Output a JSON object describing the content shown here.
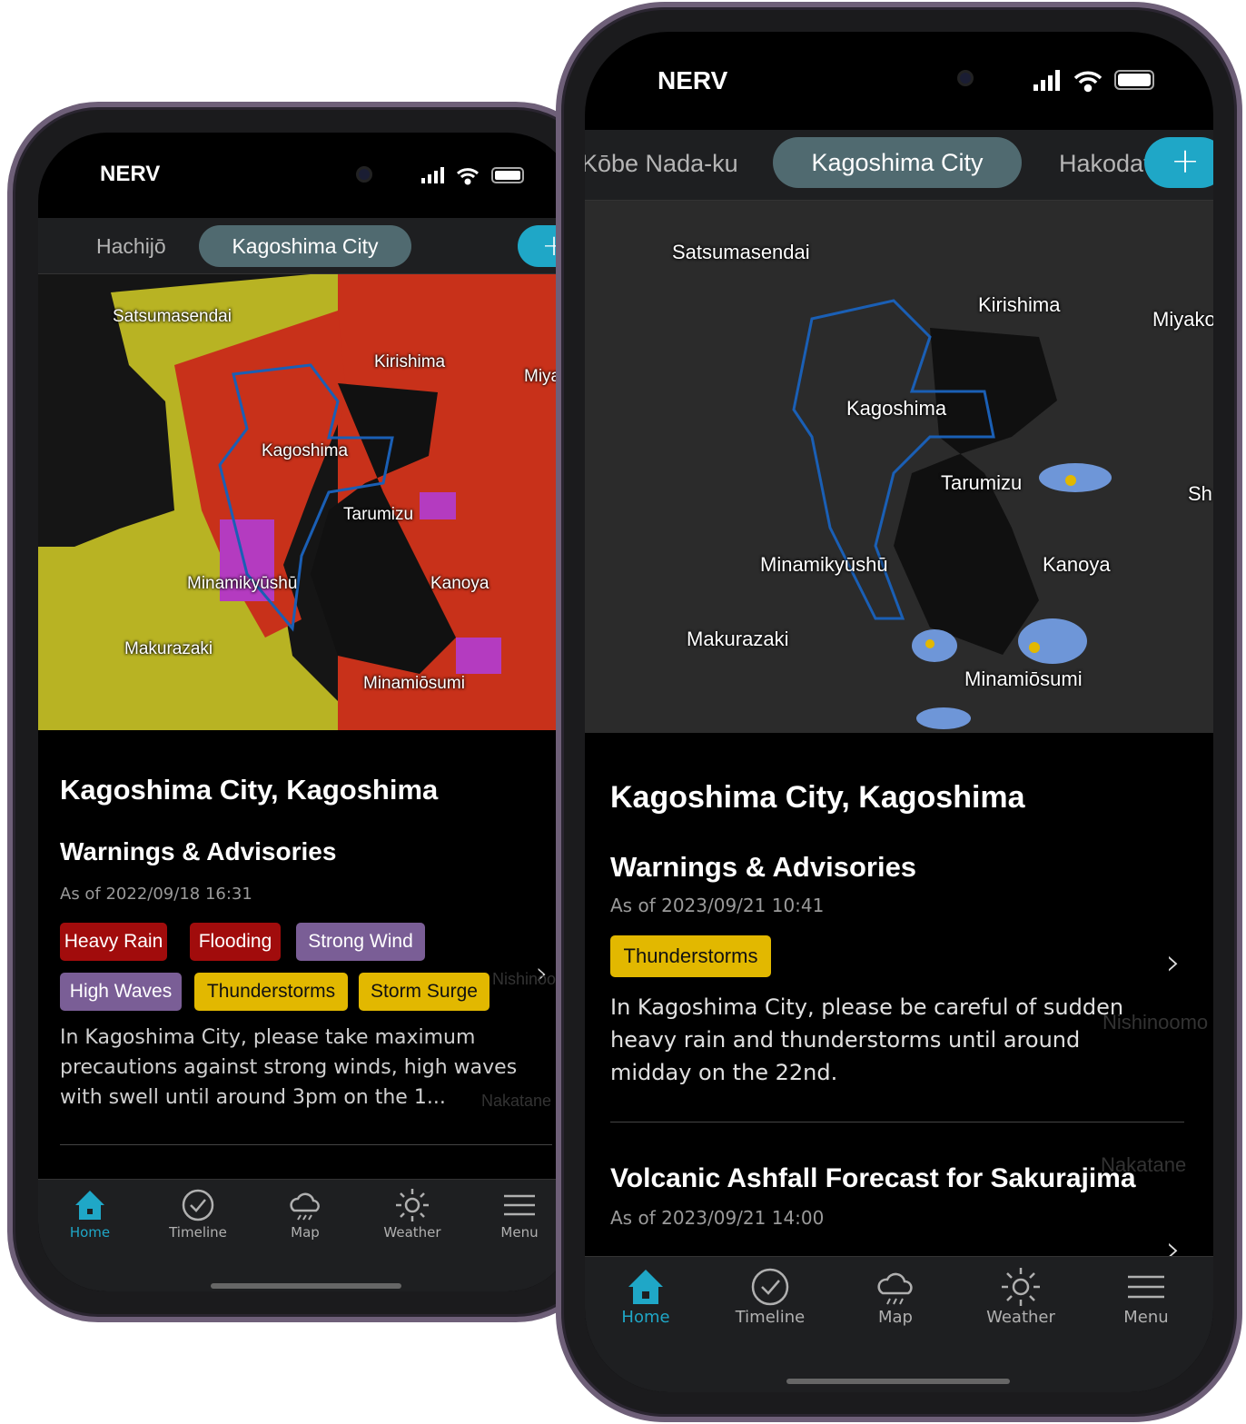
{
  "accent_color": "#1fa7c7",
  "badge_colors": {
    "red": "#a10c0c",
    "purple": "#7a5e96",
    "yellow": "#e2b800"
  },
  "left_phone": {
    "status": {
      "carrier": "NERV",
      "icons": [
        "signal-icon",
        "wifi-icon",
        "battery-icon"
      ]
    },
    "tabs": [
      {
        "label": "Hachijō"
      },
      {
        "label": "Kagoshima City",
        "active": true
      }
    ],
    "add_button": "+",
    "map_labels": [
      "Satsumasendai",
      "Kirishima",
      "Miya",
      "Kagoshima",
      "Tarumizu",
      "Minamikyūshū",
      "Kanoya",
      "Makurazaki",
      "Minamiōsumi"
    ],
    "location_title": "Kagoshima City, Kagoshima",
    "section_title": "Warnings & Advisories",
    "as_of": "As of 2022/09/18  16:31",
    "badges": [
      {
        "label": "Heavy Rain",
        "color": "red"
      },
      {
        "label": "Flooding",
        "color": "red"
      },
      {
        "label": "Strong Wind",
        "color": "purple"
      },
      {
        "label": "High Waves",
        "color": "purple"
      },
      {
        "label": "Thunderstorms",
        "color": "yellow"
      },
      {
        "label": "Storm Surge",
        "color": "yellow"
      }
    ],
    "body": "In Kagoshima City, please take maximum precautions against strong winds, high waves with swell until around 3pm on the 1...",
    "faded_labels": [
      "Nishinoom",
      "Nakatane"
    ],
    "nav": [
      {
        "label": "Home",
        "active": true
      },
      {
        "label": "Timeline"
      },
      {
        "label": "Map"
      },
      {
        "label": "Weather"
      },
      {
        "label": "Menu"
      }
    ]
  },
  "right_phone": {
    "status": {
      "carrier": "NERV",
      "icons": [
        "signal-icon",
        "wifi-icon",
        "battery-icon"
      ]
    },
    "tabs": [
      {
        "label": "Kōbe Nada-ku"
      },
      {
        "label": "Kagoshima City",
        "active": true
      },
      {
        "label": "Hakodate"
      }
    ],
    "add_button": "+",
    "map_labels": [
      "Satsumasendai",
      "Kirishima",
      "Miyako",
      "Kagoshima",
      "Tarumizu",
      "Sh",
      "Minamikyūshū",
      "Kanoya",
      "Makurazaki",
      "Minamiōsumi"
    ],
    "location_title": "Kagoshima City, Kagoshima",
    "section_title": "Warnings & Advisories",
    "as_of": "As of 2023/09/21  10:41",
    "badges": [
      {
        "label": "Thunderstorms",
        "color": "yellow"
      }
    ],
    "body": "In Kagoshima City, please be careful of sudden heavy rain and thunderstorms until around midday on the 22nd.",
    "faded_labels": [
      "Nishinoomo",
      "Nakatane"
    ],
    "volcano_title": "Volcanic Ashfall Forecast for Sakurajima",
    "volcano_as_of": "As of 2023/09/21  14:00",
    "nav": [
      {
        "label": "Home",
        "active": true
      },
      {
        "label": "Timeline"
      },
      {
        "label": "Map"
      },
      {
        "label": "Weather"
      },
      {
        "label": "Menu"
      }
    ]
  }
}
